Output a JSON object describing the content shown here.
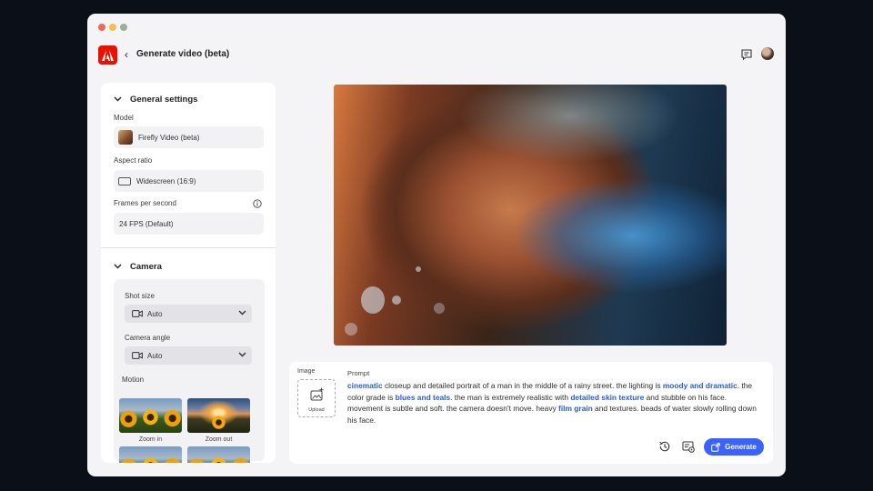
{
  "app": {
    "title": "Generate video (beta)",
    "back_icon": "chevron-left-icon",
    "logo": "adobe-logo",
    "brand_color": "#eb1000",
    "accent_color": "#3b63fb"
  },
  "settings": {
    "general": {
      "heading": "General settings",
      "model_label": "Model",
      "model_value": "Firefly Video (beta)",
      "aspect_label": "Aspect ratio",
      "aspect_value": "Widescreen (16:9)",
      "fps_label": "Frames per second",
      "fps_value": "24 FPS (Default)"
    },
    "camera": {
      "heading": "Camera",
      "shot_label": "Shot size",
      "shot_value": "Auto",
      "angle_label": "Camera angle",
      "angle_value": "Auto",
      "motion_label": "Motion",
      "motion_options": [
        {
          "label": "Zoom in"
        },
        {
          "label": "Zoom out"
        }
      ]
    }
  },
  "prompt": {
    "image_label": "Image",
    "upload_label": "Upload",
    "label": "Prompt",
    "segments": [
      {
        "text": "cinematic",
        "highlight": true
      },
      {
        "text": " closeup and detailed portrait of a man in the middle of a rainy street. the lighting is ",
        "highlight": false
      },
      {
        "text": "moody and dramatic",
        "highlight": true
      },
      {
        "text": ". the color grade is ",
        "highlight": false
      },
      {
        "text": "blues and teals",
        "highlight": true
      },
      {
        "text": ". the man is extremely realistic with ",
        "highlight": false
      },
      {
        "text": "detailed skin texture",
        "highlight": true
      },
      {
        "text": " and stubble on his face. movement is subtle and soft. the camera doesn't move. heavy ",
        "highlight": false
      },
      {
        "text": "film grain",
        "highlight": true
      },
      {
        "text": " and textures. beads of water slowly rolling down his face.",
        "highlight": false
      }
    ],
    "generate_label": "Generate"
  }
}
